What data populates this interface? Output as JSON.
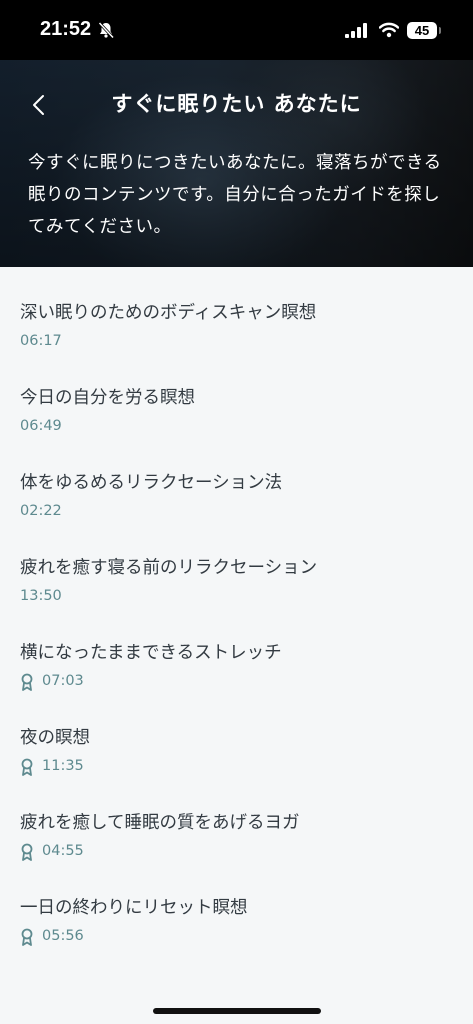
{
  "status_bar": {
    "time": "21:52",
    "battery": "45",
    "icons": [
      "bell-slash-icon",
      "signal-icon",
      "wifi-icon",
      "battery-icon"
    ]
  },
  "header": {
    "back_icon": "chevron-left-icon",
    "title": "すぐに眠りたい あなたに",
    "description": "今すぐに眠りにつきたいあなたに。寝落ちができる眠りのコンテンツです。自分に合ったガイドを探してみてください。"
  },
  "items": [
    {
      "title": "深い眠りのためのボディスキャン瞑想",
      "duration": "06:17",
      "premium": false
    },
    {
      "title": "今日の自分を労る瞑想",
      "duration": "06:49",
      "premium": false
    },
    {
      "title": "体をゆるめるリラクセーション法",
      "duration": "02:22",
      "premium": false
    },
    {
      "title": "疲れを癒す寝る前のリラクセーション",
      "duration": "13:50",
      "premium": false
    },
    {
      "title": "横になったままできるストレッチ",
      "duration": "07:03",
      "premium": true
    },
    {
      "title": "夜の瞑想",
      "duration": "11:35",
      "premium": true
    },
    {
      "title": "疲れを癒して睡眠の質をあげるヨガ",
      "duration": "04:55",
      "premium": true
    },
    {
      "title": "一日の終わりにリセット瞑想",
      "duration": "05:56",
      "premium": true
    }
  ],
  "colors": {
    "accent": "#5e8a8f",
    "text": "#333b42",
    "background": "#f5f7f8"
  }
}
